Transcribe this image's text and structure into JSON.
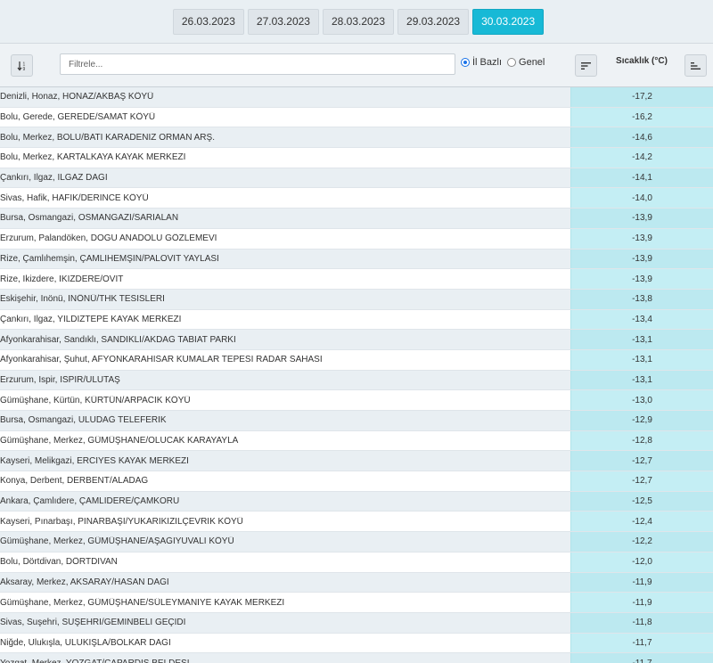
{
  "dates": [
    "26.03.2023",
    "27.03.2023",
    "28.03.2023",
    "29.03.2023",
    "30.03.2023"
  ],
  "active_date": "30.03.2023",
  "filter": {
    "placeholder": "Filtrele...",
    "value": ""
  },
  "radio": {
    "option1": "İl Bazlı",
    "option2": "Genel",
    "selected": "İl Bazlı"
  },
  "column": {
    "title": "Sıcaklık (°C)"
  },
  "icons": {
    "sort_left": "sort-numeric-icon",
    "sort_mid": "sort-desc-icon",
    "sort_right": "bar-chart-sort-icon"
  },
  "colors": {
    "accent": "#17b9d6",
    "value_bg": "#c4eef4"
  },
  "rows": [
    {
      "loc": "Denizli, Honaz, HONAZ/AKBAŞ KÖYÜ",
      "val": "-17,2"
    },
    {
      "loc": "Bolu, Gerede, GEREDE/SAMAT KÖYÜ",
      "val": "-16,2"
    },
    {
      "loc": "Bolu, Merkez, BOLU/BATI KARADENİZ ORMAN ARŞ.",
      "val": "-14,6"
    },
    {
      "loc": "Bolu, Merkez, KARTALKAYA KAYAK MERKEZİ",
      "val": "-14,2"
    },
    {
      "loc": "Çankırı, Ilgaz, ILGAZ DAĞI",
      "val": "-14,1"
    },
    {
      "loc": "Sivas, Hafik, HAFİK/DERİNCE KÖYÜ",
      "val": "-14,0"
    },
    {
      "loc": "Bursa, Osmangazi, OSMANGAZİ/SARIALAN",
      "val": "-13,9"
    },
    {
      "loc": "Erzurum, Palandöken, DOĞU ANADOLU GÖZLEMEVİ",
      "val": "-13,9"
    },
    {
      "loc": "Rize, Çamlıhemşin, ÇAMLIHEMŞİN/PALOVİT YAYLASI",
      "val": "-13,9"
    },
    {
      "loc": "Rize, İkizdere, İKİZDERE/OVİT",
      "val": "-13,9"
    },
    {
      "loc": "Eskişehir, İnönü, İNÖNÜ/THK TESİSLERİ",
      "val": "-13,8"
    },
    {
      "loc": "Çankırı, Ilgaz, YILDIZTEPE KAYAK MERKEZİ",
      "val": "-13,4"
    },
    {
      "loc": "Afyonkarahisar, Sandıklı, SANDIKLI/AKDAĞ TABİAT PARKI",
      "val": "-13,1"
    },
    {
      "loc": "Afyonkarahisar, Şuhut, AFYONKARAHİSAR KUMALAR TEPESİ RADAR SAHASI",
      "val": "-13,1"
    },
    {
      "loc": "Erzurum, İspir, İSPİR/ULUTAŞ",
      "val": "-13,1"
    },
    {
      "loc": "Gümüşhane, Kürtün, KÜRTÜN/ARPACIK KÖYÜ",
      "val": "-13,0"
    },
    {
      "loc": "Bursa, Osmangazi, ULUDAĞ TELEFERİK",
      "val": "-12,9"
    },
    {
      "loc": "Gümüşhane, Merkez, GÜMÜŞHANE/OLUCAK KARAYAYLA",
      "val": "-12,8"
    },
    {
      "loc": "Kayseri, Melikgazi, ERCİYES KAYAK MERKEZİ",
      "val": "-12,7"
    },
    {
      "loc": "Konya, Derbent, DERBENT/ALADAĞ",
      "val": "-12,7"
    },
    {
      "loc": "Ankara, Çamlıdere, ÇAMLIDERE/ÇAMKORU",
      "val": "-12,5"
    },
    {
      "loc": "Kayseri, Pınarbaşı, PINARBAŞI/YUKARIKIZILÇEVRİK KÖYÜ",
      "val": "-12,4"
    },
    {
      "loc": "Gümüşhane, Merkez, GÜMÜŞHANE/AŞAĞIYUVALI KÖYÜ",
      "val": "-12,2"
    },
    {
      "loc": "Bolu, Dörtdivan, DÖRTDİVAN",
      "val": "-12,0"
    },
    {
      "loc": "Aksaray, Merkez, AKSARAY/HASAN DAĞI",
      "val": "-11,9"
    },
    {
      "loc": "Gümüşhane, Merkez, GÜMÜŞHANE/SÜLEYMANİYE KAYAK MERKEZİ",
      "val": "-11,9"
    },
    {
      "loc": "Sivas, Suşehri, SUŞEHRİ/GEMİNBELİ GEÇİDİ",
      "val": "-11,8"
    },
    {
      "loc": "Niğde, Ulukışla, ULUKIŞLA/BOLKAR DAĞI",
      "val": "-11,7"
    },
    {
      "loc": "Yozgat, Merkez, YOZGAT/ÇAPARDIS BELDESİ",
      "val": "-11,7"
    }
  ]
}
